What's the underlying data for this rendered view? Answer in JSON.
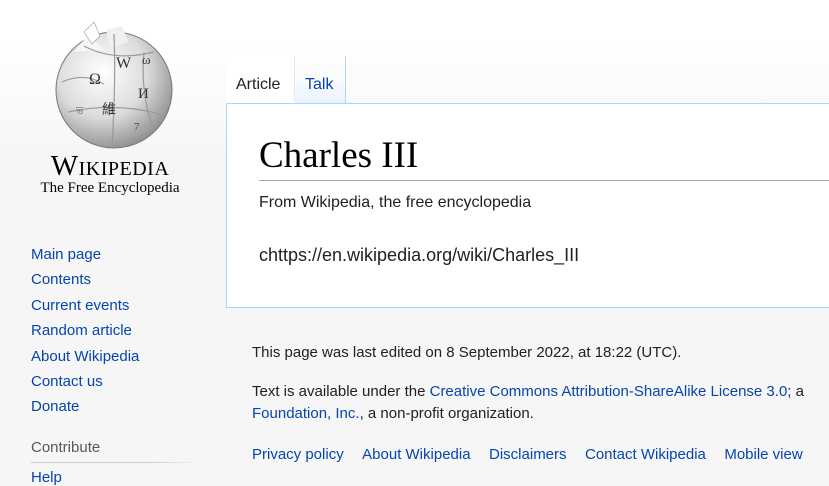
{
  "logo": {
    "wordmark": "Wikipedia",
    "tagline": "The Free Encyclopedia"
  },
  "sidebar": {
    "nav_items": [
      {
        "label": "Main page"
      },
      {
        "label": "Contents"
      },
      {
        "label": "Current events"
      },
      {
        "label": "Random article"
      },
      {
        "label": "About Wikipedia"
      },
      {
        "label": "Contact us"
      },
      {
        "label": "Donate"
      }
    ],
    "contribute_heading": "Contribute",
    "partial_item": "Help"
  },
  "tabs": {
    "article": "Article",
    "talk": "Talk"
  },
  "page": {
    "title": "Charles III",
    "subtitle": "From Wikipedia, the free encyclopedia",
    "body": "chttps://en.wikipedia.org/wiki/Charles_III"
  },
  "footer": {
    "last_modified": "This page was last edited on 8 September 2022, at 18:22 (UTC).",
    "license_prefix": "Text is available under the ",
    "license_link": "Creative Commons Attribution-ShareAlike License 3.0",
    "license_cut": "; a",
    "foundation_link": "Foundation, Inc.",
    "license_suffix": ", a non-profit organization.",
    "links": [
      {
        "label": "Privacy policy"
      },
      {
        "label": "About Wikipedia"
      },
      {
        "label": "Disclaimers"
      },
      {
        "label": "Contact Wikipedia"
      },
      {
        "label": "Mobile view"
      }
    ]
  },
  "colors": {
    "link": "#0645ad",
    "tab_border": "#a7d7f9",
    "sidebar_bg": "#f6f6f6"
  }
}
